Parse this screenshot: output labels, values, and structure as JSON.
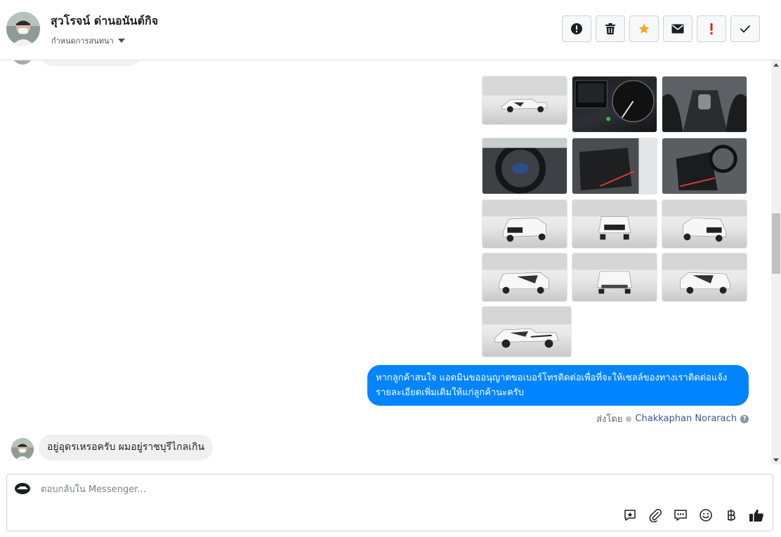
{
  "header": {
    "contact_name": "สุวโรจน์ ด่านอนันต์กิจ",
    "assign_label": "กำหนดการสนทนา",
    "actions": [
      {
        "name": "spam-button",
        "icon": "alert-circle-icon"
      },
      {
        "name": "delete-button",
        "icon": "trash-icon"
      },
      {
        "name": "star-button",
        "icon": "star-icon"
      },
      {
        "name": "mark-unread-button",
        "icon": "envelope-icon"
      },
      {
        "name": "flag-button",
        "icon": "exclamation-icon"
      },
      {
        "name": "mark-done-button",
        "icon": "checkmark-icon"
      }
    ]
  },
  "thread": {
    "outgoing_message": "หากลูกค้าสนใจ แอดมินขออนุญาตขอเบอร์โทรติดต่อเพื่อที่จะให้เซลล์ของทางเราติดต่อแจ้งรายละเอียดเพิ่มเติมให้แก่ลูกค้านะครับ",
    "sent_by_label": "ส่งโดย",
    "sent_by_name": "Chakkaphan Norarach",
    "incoming_message": "อยู่อุดรเหรอครับ ผมอยู่ราชบุรีไกลเกิน",
    "photos_count": 13
  },
  "composer": {
    "placeholder": "ตอบกลับใน Messenger...",
    "tools": [
      "saved-reply-icon",
      "paperclip-icon",
      "chat-bubbles-icon",
      "smiley-icon",
      "baht-icon",
      "thumbs-up-icon"
    ]
  },
  "colors": {
    "accent": "#0084ff",
    "star": "#f5a623",
    "flag": "#e02020",
    "bubble_incoming": "#f0f0f0"
  }
}
